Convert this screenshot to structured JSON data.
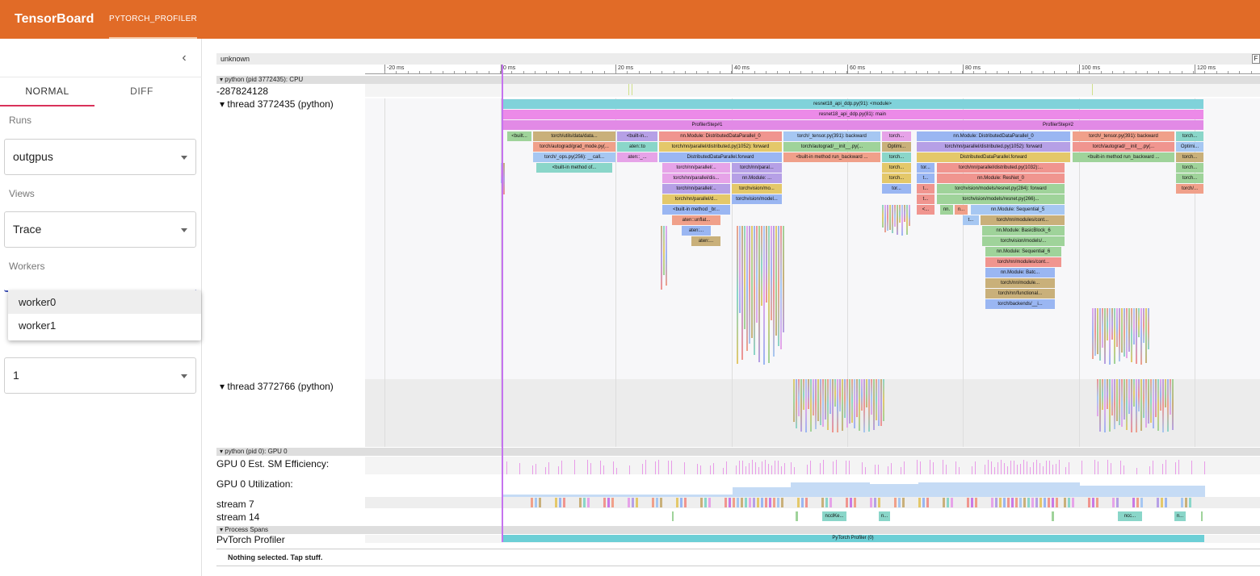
{
  "header": {
    "title": "TensorBoard",
    "plugin_tab": "PYTORCH_PROFILER"
  },
  "sidebar": {
    "collapse_icon": "‹",
    "tabs": [
      {
        "label": "NORMAL",
        "active": true
      },
      {
        "label": "DIFF",
        "active": false
      }
    ],
    "runs_label": "Runs",
    "runs_value": "outgpus",
    "views_label": "Views",
    "views_value": "Trace",
    "workers_label": "Workers",
    "workers_options": [
      "worker0",
      "worker1"
    ],
    "span_value": "1"
  },
  "viewer": {
    "process_name": "unknown",
    "f_button": "F",
    "ruler_ticks": [
      "-20 ms",
      "0 ms",
      "20 ms",
      "40 ms",
      "60 ms",
      "80 ms",
      "100 ms",
      "120 ms"
    ],
    "cpu_header": "python (pid 3772435): CPU",
    "cpu_counter": "-287824128",
    "thread1": "thread 3772435 (python)",
    "thread2": "thread 3772766 (python)",
    "gpu_header": "python (pid 0): GPU 0",
    "gpu_sm": "GPU 0 Est. SM Efficiency:",
    "gpu_util": "GPU 0 Utilization:",
    "stream7": "stream 7",
    "stream14": "stream 14",
    "spans_header": "Process Spans",
    "spans_track": "PyTorch Profiler",
    "spans_slice": "PyTorch Profiler (0)",
    "slices": {
      "module": "resnet18_api_ddp.py(91): <module>",
      "main": "resnet18_api_ddp.py(81): main",
      "step1": "ProfilerStep#1",
      "step2": "ProfilerStep#2",
      "row3a": [
        "<built...",
        "torch/utils/data/data...",
        "<built-in...",
        "nn.Module: DistributedDataParallel_0",
        "torch/_tensor.py(391): backward",
        "torch...",
        "nn.Module: DistributedDataParallel_0",
        "torch/_tensor.py(391): backward",
        "torch..."
      ],
      "row4a": [
        "torch/autograd/grad_mode.py(...",
        "aten::to",
        "torch/nn/parallel/distributed.py(1052): forward",
        "torch/autograd/__init__.py(...",
        "Optimi...",
        "torch/nn/parallel/distributed.py(1052): forward",
        "torch/autograd/__init__.py(...",
        "Optimi..."
      ],
      "row5a": [
        "torch/_ops.py(256): __call...",
        "aten::_...",
        "DistributedDataParallel.forward",
        "<built-in method run_backward ...",
        "torch...",
        "DistributedDataParallel.forward",
        "<built-in method run_backward ...",
        "torch..."
      ],
      "row6a": [
        "<built-in method of...",
        "torch/nn/parallel/...",
        "torch/nn/paral...",
        "torch...",
        "tor...",
        "torch/nn/parallel/distributed.py(1032):...",
        "torch..."
      ],
      "row7a": [
        "torch/nn/parallel/dis...",
        "nn.Module: ...",
        "torch...",
        "t...",
        "nn.Module: ResNet_0",
        "torch..."
      ],
      "row8a": [
        "torch/nn/parallel/...",
        "torchvision/mo...",
        "tor...",
        "t...",
        "torchvision/models/resnet.py(284): forward",
        "torch/..."
      ],
      "row9a": [
        "torch/nn/parallel/d...",
        "torchvision/model...",
        "t...",
        "torchvision/models/resnet.py(266)..."
      ],
      "row10a": [
        "<built-in method _br...",
        "<...",
        "nn.",
        "n...",
        "nn.Module: Sequential_5"
      ],
      "row11a": [
        "aten::unflat...",
        "t...",
        "torch/nn/modules/cont..."
      ],
      "row12a": [
        "aten:...",
        "nn.Module: BasicBlock_6"
      ],
      "row13a": [
        "aten:...",
        "torchvision/models/..."
      ],
      "row14a": [
        "nn.Module: Sequential_6"
      ],
      "row15a": [
        "torch/nn/modules/cont..."
      ],
      "row16a": [
        "nn.Module: Batc..."
      ],
      "row17a": [
        "torch/nn/module..."
      ],
      "row18a": [
        "torch/nn/functional..."
      ],
      "row19a": [
        "torch/backends/__i..."
      ],
      "stream14": [
        "ncclKe...",
        "n...",
        "ncc...",
        "n..."
      ]
    }
  },
  "status": "Nothing selected. Tap stuff.",
  "colors": {
    "header": "#e16b27",
    "playhead": "#c573ef",
    "tab_underline": "#d9325a"
  }
}
